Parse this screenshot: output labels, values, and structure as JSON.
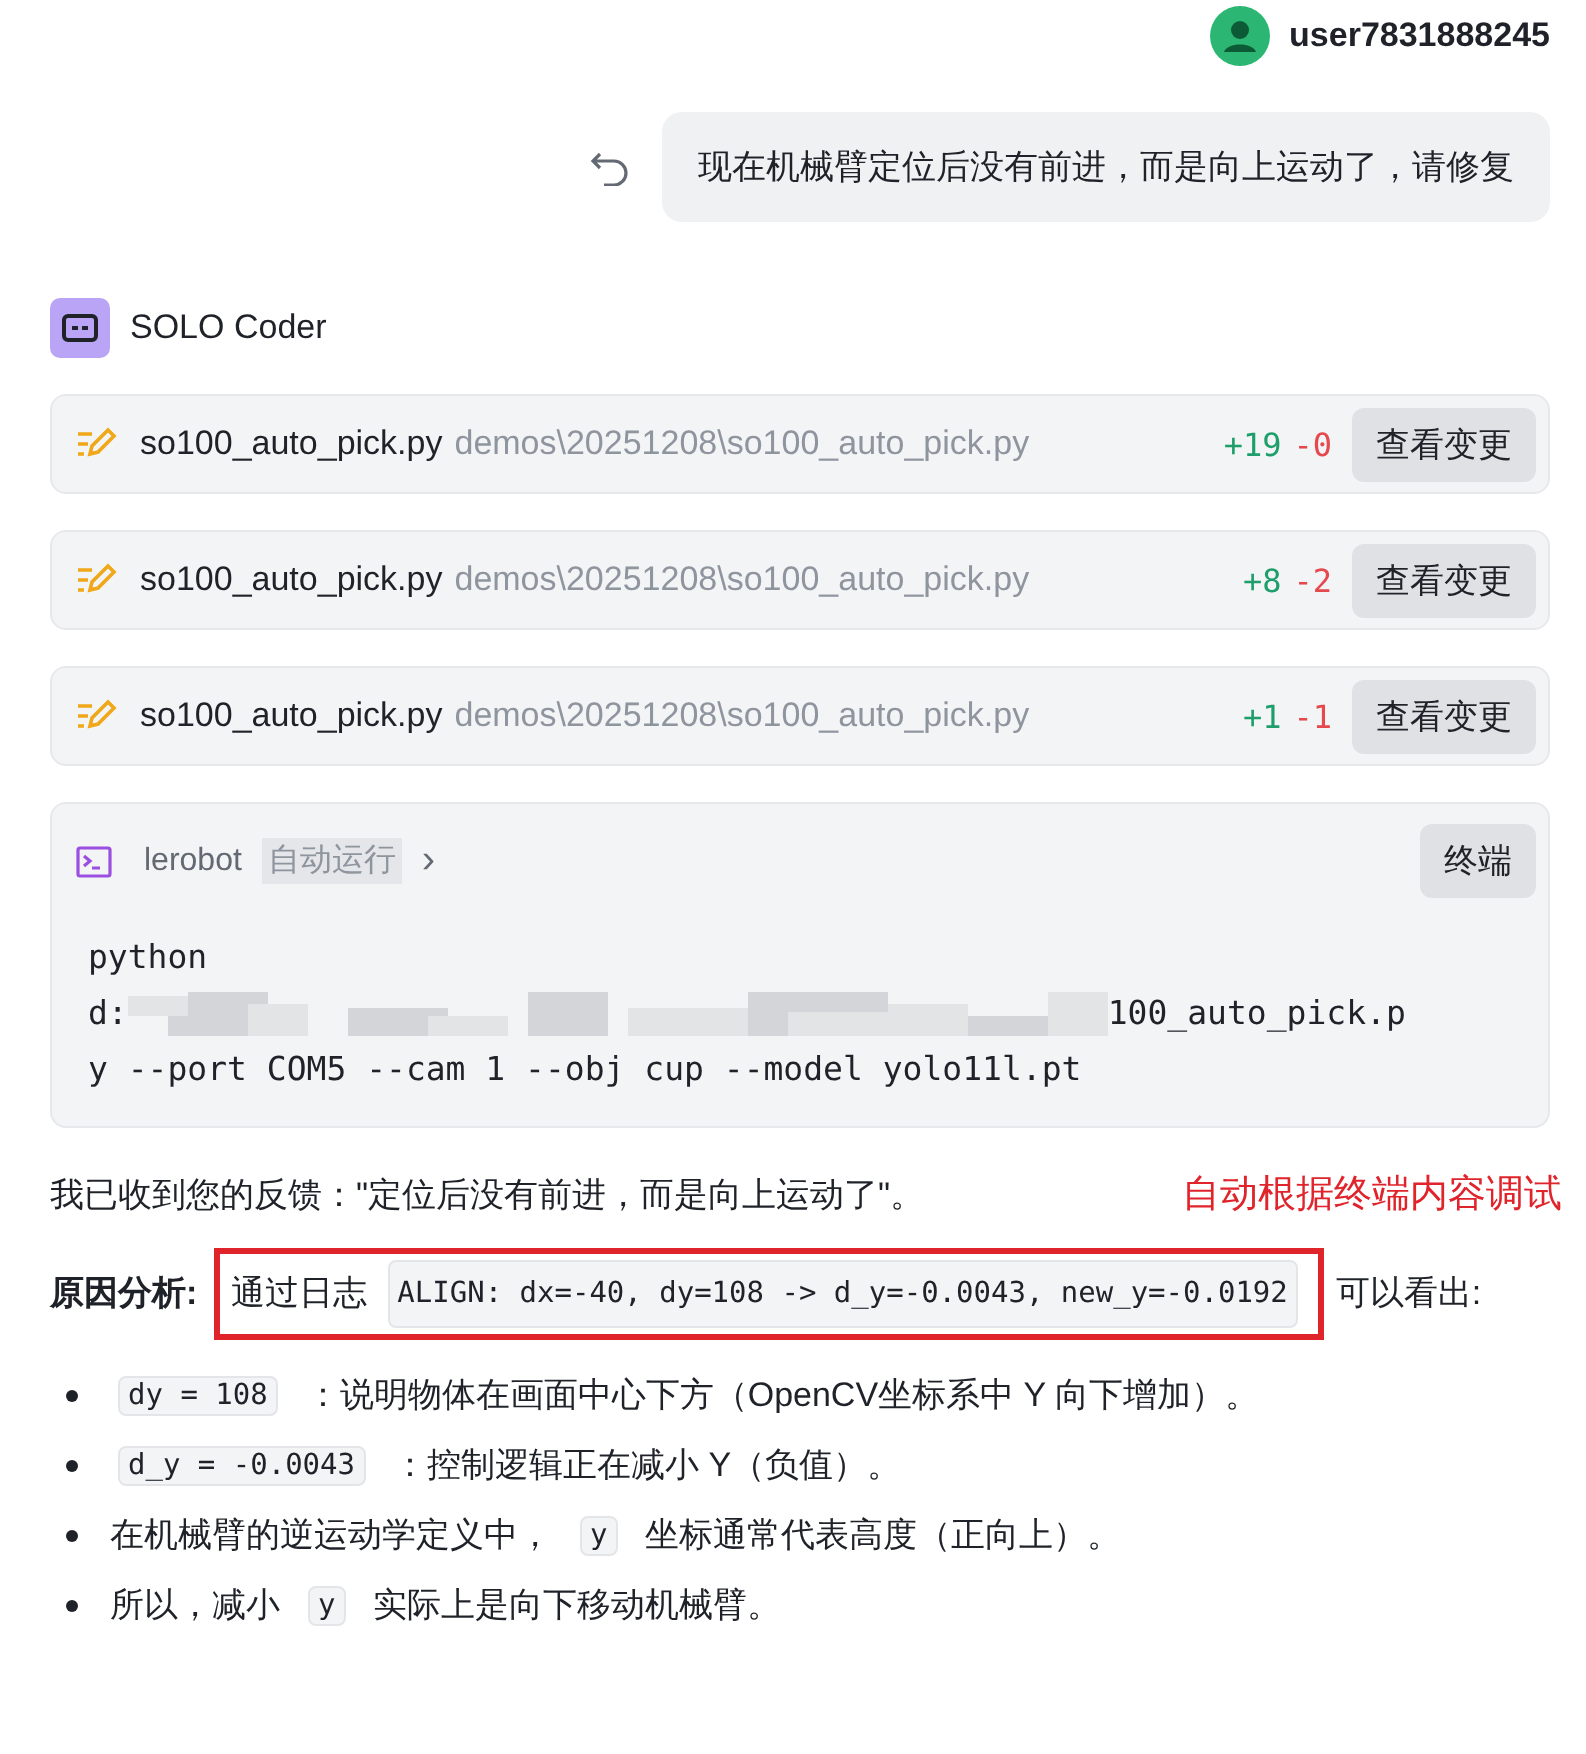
{
  "user": {
    "name": "user7831888245"
  },
  "message": {
    "text": "现在机械臂定位后没有前进，而是向上运动了，请修复"
  },
  "agent": {
    "name": "SOLO Coder"
  },
  "files": [
    {
      "name": "so100_auto_pick.py",
      "path": "demos\\20251208\\so100_auto_pick.py",
      "added": "+19",
      "removed": "-0",
      "button": "查看变更"
    },
    {
      "name": "so100_auto_pick.py",
      "path": "demos\\20251208\\so100_auto_pick.py",
      "added": "+8",
      "removed": "-2",
      "button": "查看变更"
    },
    {
      "name": "so100_auto_pick.py",
      "path": "demos\\20251208\\so100_auto_pick.py",
      "added": "+1",
      "removed": "-1",
      "button": "查看变更"
    }
  ],
  "terminal": {
    "name": "lerobot",
    "tag": "自动运行",
    "chevron": "›",
    "button": "终端",
    "lines": [
      {
        "kind": "plain",
        "text": "python"
      },
      {
        "kind": "redacted",
        "prefix": "d:",
        "suffix": "100_auto_pick.p"
      },
      {
        "kind": "plain",
        "text": "y --port COM5 --cam 1 --obj cup --model yolo11l.pt"
      }
    ]
  },
  "feedback": {
    "text": "我已收到您的反馈：\"定位后没有前进，而是向上运动了\"。",
    "annotation": "自动根据终端内容调试"
  },
  "analysis": {
    "label": "原因分析:",
    "highlighted": [
      {
        "kind": "text",
        "text": "通过日志"
      },
      {
        "kind": "code",
        "text": "ALIGN: dx=-40, dy=108 -> d_y=-0.0043, new_y=-0.0192"
      }
    ],
    "rest": "可以看出:"
  },
  "bullets": [
    [
      {
        "kind": "code",
        "text": "dy = 108"
      },
      {
        "kind": "text",
        "text": "：说明物体在画面中心下方（OpenCV坐标系中 Y 向下增加）。"
      }
    ],
    [
      {
        "kind": "code",
        "text": "d_y = -0.0043"
      },
      {
        "kind": "text",
        "text": "：控制逻辑正在减小 Y（负值）。"
      }
    ],
    [
      {
        "kind": "text",
        "text": "在机械臂的逆运动学定义中，"
      },
      {
        "kind": "code",
        "text": "y"
      },
      {
        "kind": "text",
        "text": "坐标通常代表高度（正向上）。"
      }
    ],
    [
      {
        "kind": "text",
        "text": "所以，减小"
      },
      {
        "kind": "code",
        "text": "y"
      },
      {
        "kind": "text",
        "text": "实际上是向下移动机械臂。"
      }
    ]
  ]
}
